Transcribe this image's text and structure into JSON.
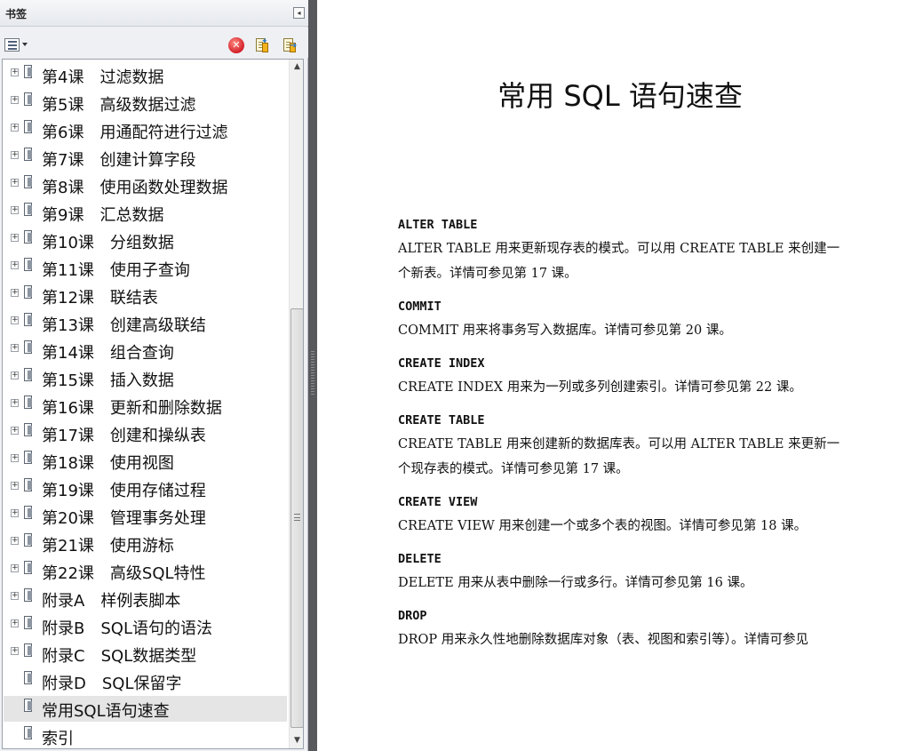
{
  "panel": {
    "title": "书签",
    "collapse_glyph": "◂",
    "toolbar": {
      "options_icon": "list-options-icon",
      "delete_icon": "delete-icon",
      "new_icon": "new-bookmark-icon",
      "expand_icon": "expand-bookmark-icon"
    },
    "items": [
      {
        "label": "第4课　过滤数据",
        "expandable": true
      },
      {
        "label": "第5课　高级数据过滤",
        "expandable": true
      },
      {
        "label": "第6课　用通配符进行过滤",
        "expandable": true
      },
      {
        "label": "第7课　创建计算字段",
        "expandable": true
      },
      {
        "label": "第8课　使用函数处理数据",
        "expandable": true
      },
      {
        "label": "第9课　汇总数据",
        "expandable": true
      },
      {
        "label": "第10课　分组数据",
        "expandable": true
      },
      {
        "label": "第11课　使用子查询",
        "expandable": true
      },
      {
        "label": "第12课　联结表",
        "expandable": true
      },
      {
        "label": "第13课　创建高级联结",
        "expandable": true
      },
      {
        "label": "第14课　组合查询",
        "expandable": true
      },
      {
        "label": "第15课　插入数据",
        "expandable": true
      },
      {
        "label": "第16课　更新和删除数据",
        "expandable": true
      },
      {
        "label": "第17课　创建和操纵表",
        "expandable": true
      },
      {
        "label": "第18课　使用视图",
        "expandable": true
      },
      {
        "label": "第19课　使用存储过程",
        "expandable": true
      },
      {
        "label": "第20课　管理事务处理",
        "expandable": true
      },
      {
        "label": "第21课　使用游标",
        "expandable": true
      },
      {
        "label": "第22课　高级SQL特性",
        "expandable": true
      },
      {
        "label": "附录A　样例表脚本",
        "expandable": true
      },
      {
        "label": "附录B　SQL语句的语法",
        "expandable": true
      },
      {
        "label": "附录C　SQL数据类型",
        "expandable": true
      },
      {
        "label": "附录D　SQL保留字",
        "expandable": false
      },
      {
        "label": "常用SQL语句速查",
        "expandable": false,
        "selected": true
      },
      {
        "label": "索引",
        "expandable": false
      }
    ]
  },
  "document": {
    "title": "常用 SQL 语句速查",
    "entries": [
      {
        "term": "ALTER TABLE",
        "lines": [
          "ALTER TABLE 用来更新现存表的模式。可以用 CREATE TABLE 来创建一",
          "个新表。详情可参见第 17 课。"
        ]
      },
      {
        "term": "COMMIT",
        "lines": [
          "COMMIT 用来将事务写入数据库。详情可参见第 20 课。"
        ]
      },
      {
        "term": "CREATE INDEX",
        "lines": [
          "CREATE INDEX 用来为一列或多列创建索引。详情可参见第 22 课。"
        ]
      },
      {
        "term": "CREATE TABLE",
        "lines": [
          "CREATE TABLE 用来创建新的数据库表。可以用 ALTER TABLE 来更新一",
          "个现存表的模式。详情可参见第 17 课。"
        ]
      },
      {
        "term": "CREATE VIEW",
        "lines": [
          "CREATE VIEW 用来创建一个或多个表的视图。详情可参见第 18 课。"
        ]
      },
      {
        "term": "DELETE",
        "lines": [
          "DELETE 用来从表中删除一行或多行。详情可参见第 16 课。"
        ]
      },
      {
        "term": "DROP",
        "lines": [
          "DROP 用来永久性地删除数据库对象（表、视图和索引等）。详情可参见"
        ]
      }
    ]
  }
}
